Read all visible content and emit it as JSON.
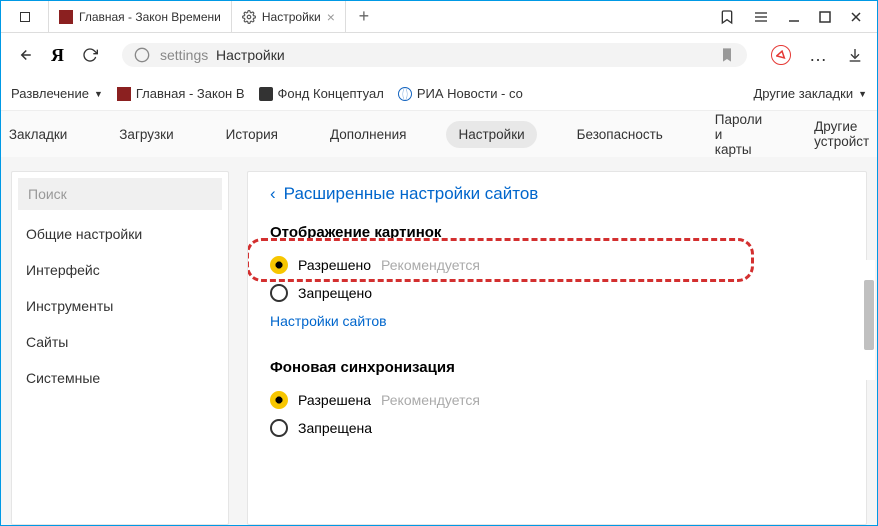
{
  "tabs": [
    {
      "label": "Главная - Закон Времени"
    },
    {
      "label": "Настройки"
    }
  ],
  "address": {
    "host": "settings",
    "title": "Настройки"
  },
  "bookmarks": {
    "items": [
      "Развлечение",
      "Главная - Закон В",
      "Фонд Концептуал",
      "РИА Новости - со"
    ],
    "other": "Другие закладки"
  },
  "navTabs": [
    "Закладки",
    "Загрузки",
    "История",
    "Дополнения",
    "Настройки",
    "Безопасность",
    "Пароли и карты",
    "Другие устройст"
  ],
  "navActiveIndex": 4,
  "sidebar": {
    "searchPlaceholder": "Поиск",
    "items": [
      "Общие настройки",
      "Интерфейс",
      "Инструменты",
      "Сайты",
      "Системные"
    ]
  },
  "main": {
    "backLink": "Расширенные настройки сайтов",
    "section1": {
      "title": "Отображение картинок",
      "option1": "Разрешено",
      "hint1": "Рекомендуется",
      "option2": "Запрещено",
      "link": "Настройки сайтов"
    },
    "section2": {
      "title": "Фоновая синхронизация",
      "option1": "Разрешена",
      "hint1": "Рекомендуется",
      "option2": "Запрещена"
    }
  }
}
